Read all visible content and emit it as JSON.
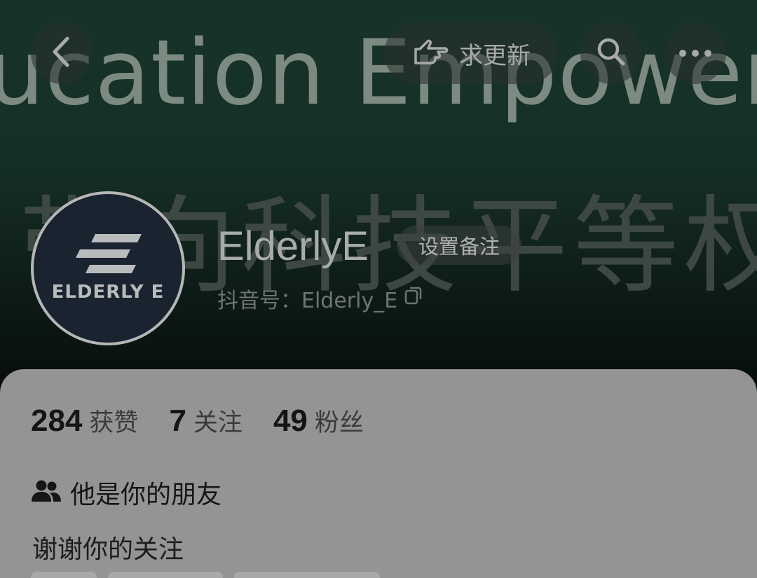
{
  "banner": {
    "line1": "ucation Empowers El",
    "line2": "带向科技平等权"
  },
  "header": {
    "update_label": "求更新"
  },
  "avatar": {
    "logo_text": "ELDERLY E"
  },
  "profile": {
    "name": "ElderlyE",
    "remark_button": "设置备注",
    "douyin_id": "抖音号：Elderly_E"
  },
  "stats": [
    {
      "value": "284",
      "label": "获赞"
    },
    {
      "value": "7",
      "label": "关注"
    },
    {
      "value": "49",
      "label": "粉丝"
    }
  ],
  "friend_status": "他是你的朋友",
  "bio": "谢谢你的关注",
  "colors": {
    "banner": "#163026",
    "panel": "#949494",
    "avatar_bg": "#1a2330"
  }
}
